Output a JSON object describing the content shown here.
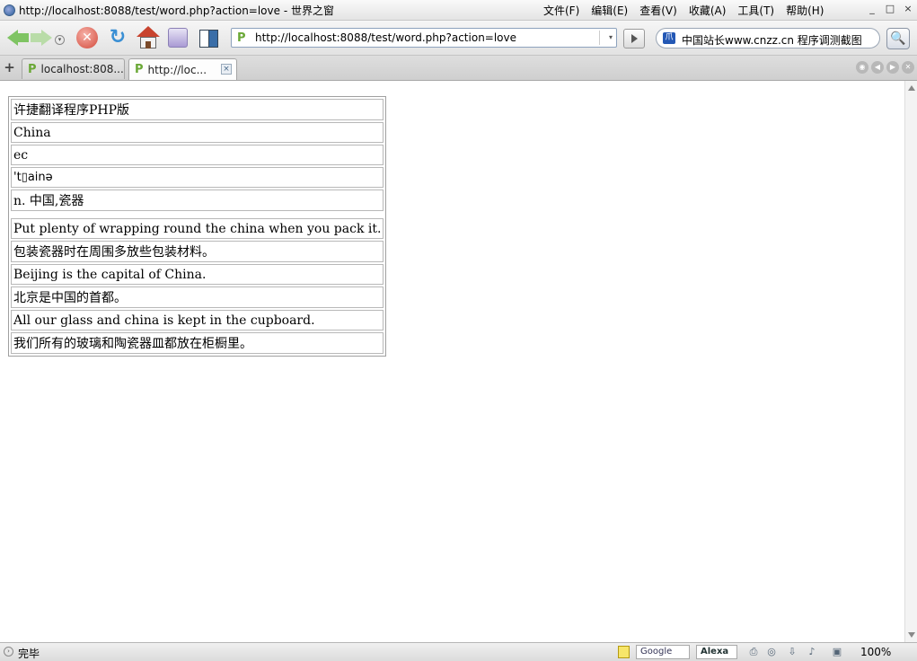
{
  "window": {
    "title": "http://localhost:8088/test/word.php?action=love - 世界之窗",
    "controls": [
      "_",
      "□",
      "×"
    ]
  },
  "menu": {
    "items": [
      "文件(F)",
      "编辑(E)",
      "查看(V)",
      "收藏(A)",
      "工具(T)",
      "帮助(H)"
    ]
  },
  "toolbar": {
    "stop_glyph": "✕",
    "refresh_glyph": "↻",
    "dropdown_glyph": "▾",
    "go_label": "",
    "search_glyph": "🔍"
  },
  "address": {
    "site_icon": "P",
    "url": "http://localhost:8088/test/word.php?action=love",
    "dropdown_glyph": "▾"
  },
  "search": {
    "engine_icon": "爪",
    "engine_label": "中国站长www.cnzz.cn 程序调测截图"
  },
  "tabs": [
    {
      "icon": "P",
      "label": "localhost:808...",
      "active": false
    },
    {
      "icon": "P",
      "label": "http://loc...",
      "active": true,
      "close": "×"
    }
  ],
  "tabbar": {
    "new_tab": "+",
    "nav": [
      "◉",
      "◀",
      "▶",
      "✕"
    ]
  },
  "word": {
    "title": "许捷翻译程序PHP版",
    "word": "China",
    "lang": "ec",
    "phonetic": "'t▯ainə",
    "definition": "n. 中国,瓷器",
    "examples": [
      {
        "en": "Put plenty of wrapping round the china when you pack it.",
        "zh": "包装瓷器时在周围多放些包装材料。"
      },
      {
        "en": "Beijing is the capital of China.",
        "zh": "北京是中国的首都。"
      },
      {
        "en": "All our glass and china is kept in the cupboard.",
        "zh": "我们所有的玻璃和陶瓷器皿都放在柜橱里。"
      }
    ]
  },
  "status": {
    "text": "完毕",
    "google": "Google",
    "alexa": "Alexa",
    "zoom": "100%"
  }
}
